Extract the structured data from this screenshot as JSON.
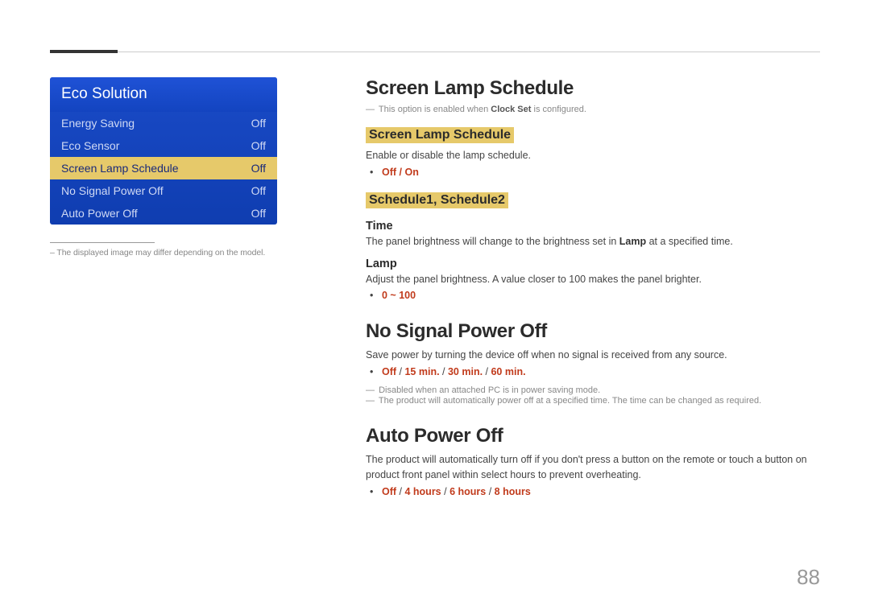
{
  "sidebar": {
    "menu_title": "Eco Solution",
    "items": [
      {
        "label": "Energy Saving",
        "value": "Off",
        "selected": false
      },
      {
        "label": "Eco Sensor",
        "value": "Off",
        "selected": false
      },
      {
        "label": "Screen Lamp Schedule",
        "value": "Off",
        "selected": true
      },
      {
        "label": "No Signal Power Off",
        "value": "Off",
        "selected": false
      },
      {
        "label": "Auto Power Off",
        "value": "Off",
        "selected": false
      }
    ],
    "note_prefix": "–  ",
    "note": "The displayed image may differ depending on the model."
  },
  "sections": {
    "sls": {
      "title": "Screen Lamp Schedule",
      "note_dash": "―",
      "note_pre": "This option is enabled when ",
      "note_bold": "Clock Set",
      "note_post": " is configured.",
      "sub1": "Screen Lamp Schedule",
      "sub1_desc": "Enable or disable the lamp schedule.",
      "sub1_opts": "Off / On",
      "sub2": "Schedule1, Schedule2",
      "time_head": "Time",
      "time_desc_pre": "The panel brightness will change to the brightness set in ",
      "time_desc_bold": "Lamp",
      "time_desc_post": " at a specified time.",
      "lamp_head": "Lamp",
      "lamp_desc": "Adjust the panel brightness. A value closer to 100 makes the panel brighter.",
      "lamp_opts": "0 ~ 100"
    },
    "nspo": {
      "title": "No Signal Power Off",
      "desc": "Save power by turning the device off when no signal is received from any source.",
      "opts_parts": [
        "Off",
        "15 min.",
        "30 min.",
        "60 min."
      ],
      "note1_dash": "―",
      "note1": "Disabled when an attached PC is in power saving mode.",
      "note2_dash": "―",
      "note2": "The product will automatically power off at a specified time. The time can be changed as required."
    },
    "apo": {
      "title": "Auto Power Off",
      "desc": "The product will automatically turn off if you don't press a button on the remote or touch a button on product front panel within select hours to prevent overheating.",
      "opts_parts": [
        "Off",
        "4 hours",
        "6 hours",
        "8 hours"
      ]
    }
  },
  "page_number": "88"
}
